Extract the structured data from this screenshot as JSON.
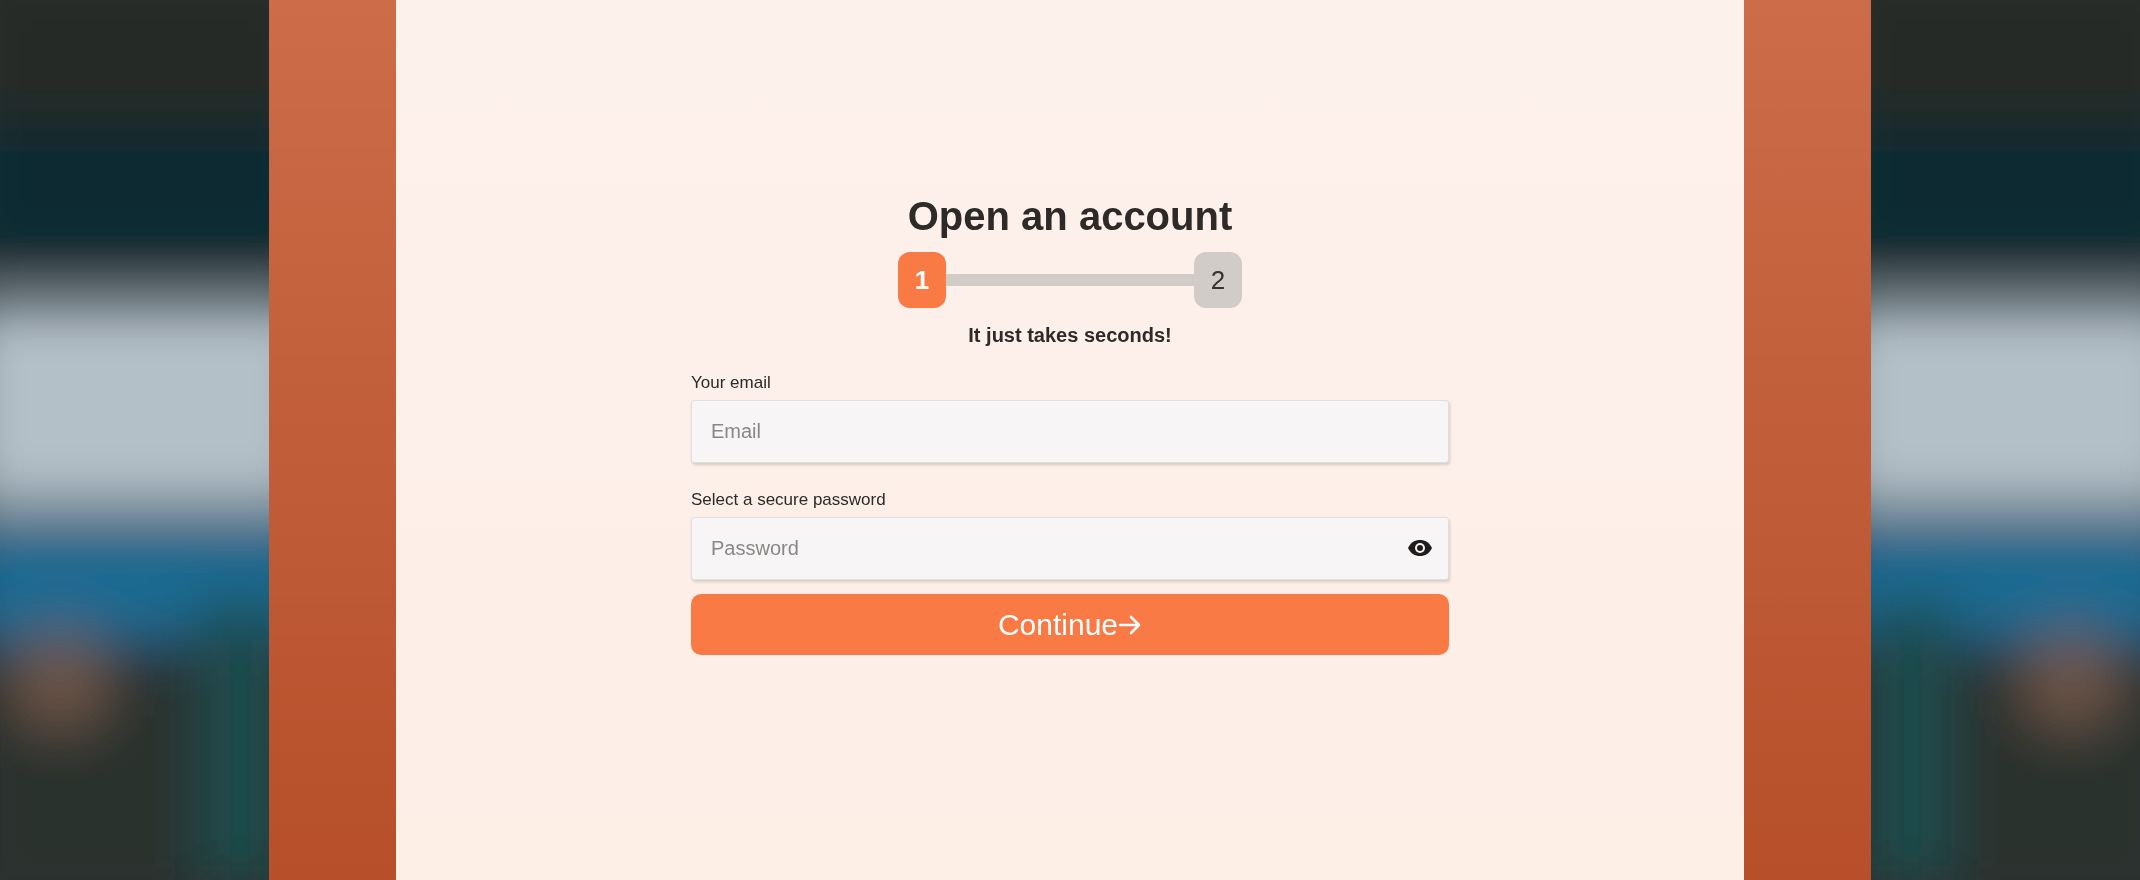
{
  "title": "Open an account",
  "steps": [
    {
      "label": "1",
      "selected": true
    },
    {
      "label": "2",
      "selected": false
    }
  ],
  "subtitle": "It just takes seconds!",
  "fields": [
    {
      "kind": "email",
      "label": "Your email",
      "placeholder": "Email"
    },
    {
      "kind": "password",
      "label": "Select a secure password",
      "placeholder": "Password"
    }
  ],
  "button": "Continue"
}
